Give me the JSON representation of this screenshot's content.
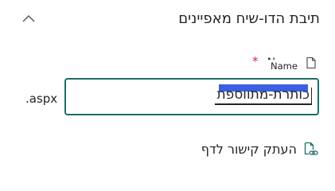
{
  "panel": {
    "title": "תיבת הדו-שיח מאפיינים",
    "collapse_icon": "chevron-up-icon"
  },
  "name_field": {
    "label": "Name",
    "tooltip": "Name",
    "required_marker": "*",
    "label_icon": "document-icon",
    "value": "כותרת-מתווספת",
    "suffix": ".aspx",
    "accent_color": "#1b6e69"
  },
  "copy_link": {
    "label": "העתק קישור לדף",
    "icon": "copy-link-icon"
  }
}
